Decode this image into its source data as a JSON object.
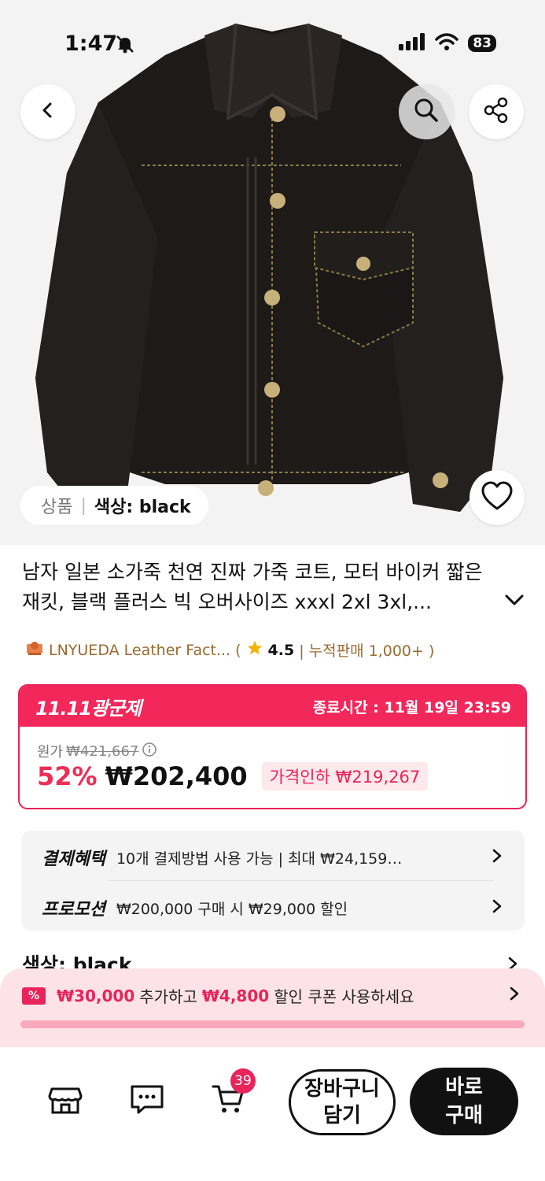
{
  "status_bar": {
    "time": "1:47",
    "battery": "83"
  },
  "hero": {
    "breadcrumb_category": "상품",
    "breadcrumb_option": "색상: black"
  },
  "product": {
    "title": "남자 일본 소가죽 천연 진짜 가죽 코트, 모터 바이커 짧은 재킷, 블랙 플러스 빅 오버사이즈 xxxl 2xl 3xl,..."
  },
  "seller": {
    "name": "LNYUEDA Leather Fact...",
    "open_paren": "(",
    "rating": "4.5",
    "sales": "| 누적판매 1,000+ )"
  },
  "deal": {
    "event_label": "11.11광군제",
    "end_time": "종료시간 : 11월 19일 23:59",
    "original_label": "원가",
    "original_price": "₩421,667",
    "discount_pct": "52%",
    "price": "₩202,400",
    "price_cut": "가격인하 ₩219,267"
  },
  "benefits": {
    "payment_label": "결제혜택",
    "payment_text": "10개 결제방법 사용 가능 | 최대 ₩24,159…",
    "promo_label": "프로모션",
    "promo_text": "₩200,000 구매 시 ₩29,000 할인"
  },
  "color_option": {
    "label": "색상: black"
  },
  "coupon": {
    "amount1": "₩30,000",
    "text1": "추가하고",
    "amount2": "₩4,800",
    "text2": "할인 쿠폰 사용하세요"
  },
  "bottom_bar": {
    "cart_count": "39",
    "add_to_cart": "장바구니 담기",
    "buy_now": "바로 구매"
  },
  "colors": {
    "accent": "#e8245a",
    "seller": "#9a6a2e"
  }
}
